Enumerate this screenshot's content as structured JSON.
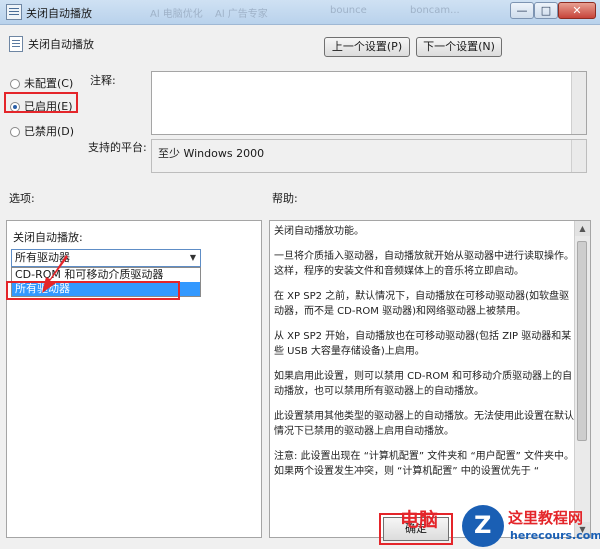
{
  "window": {
    "title": "关闭自动播放",
    "background_ghost_texts": [
      "Al 电脑优化",
      "Al 广告专家",
      "bounce",
      "boncam..."
    ],
    "min_glyph": "—",
    "max_glyph": "□",
    "close_glyph": "✕"
  },
  "header": {
    "policy_name": "关闭自动播放",
    "prev_button": "上一个设置(P)",
    "next_button": "下一个设置(N)"
  },
  "state_options": [
    {
      "label": "未配置(C)",
      "selected": false
    },
    {
      "label": "已启用(E)",
      "selected": true
    },
    {
      "label": "已禁用(D)",
      "selected": false
    }
  ],
  "notes": {
    "label": "注释:",
    "value": ""
  },
  "platform": {
    "label": "支持的平台:",
    "value": "至少 Windows 2000"
  },
  "sections": {
    "options": "选项:",
    "help": "帮助:"
  },
  "options": {
    "caption": "关闭自动播放:",
    "selected": "所有驱动器",
    "dropdown_items": [
      "CD-ROM 和可移动介质驱动器",
      "所有驱动器"
    ],
    "highlighted_item": "所有驱动器"
  },
  "help": {
    "paragraphs": [
      "关闭自动播放功能。",
      "一旦将介质插入驱动器，自动播放就开始从驱动器中进行读取操作。这样，程序的安装文件和音频媒体上的音乐将立即启动。",
      "在 XP SP2 之前，默认情况下，自动播放在可移动驱动器(如软盘驱动器，而不是 CD-ROM 驱动器)和网络驱动器上被禁用。",
      "从 XP SP2 开始，自动播放也在可移动驱动器(包括 ZIP 驱动器和某些 USB 大容量存储设备)上启用。",
      "如果启用此设置，则可以禁用 CD-ROM 和可移动介质驱动器上的自动播放，也可以禁用所有驱动器上的自动播放。",
      "此设置禁用其他类型的驱动器上的自动播放。无法使用此设置在默认情况下已禁用的驱动器上启用自动播放。",
      "注意: 此设置出现在 “计算机配置” 文件夹和 “用户配置” 文件夹中。如果两个设置发生冲突，则 “计算机配置” 中的设置优先于 “"
    ]
  },
  "footer": {
    "ok_button": "确定"
  },
  "watermark": {
    "text": "电脑",
    "site_name": "这里教程网",
    "site_url": "herecours.com"
  },
  "colors": {
    "highlight": "#e4252a",
    "selection": "#3399ff",
    "logo_blue": "#1a5fb4"
  }
}
